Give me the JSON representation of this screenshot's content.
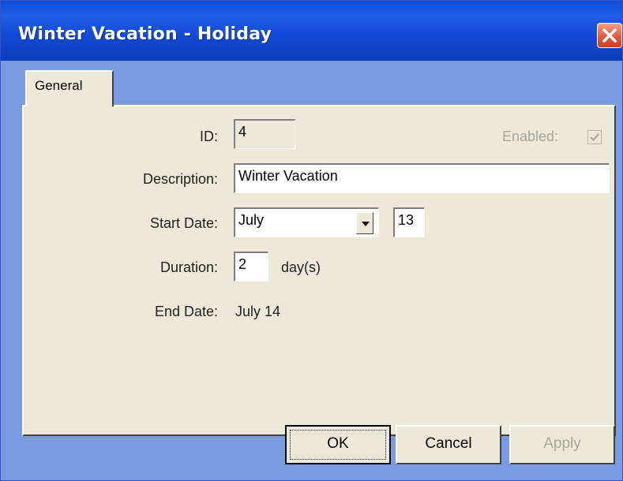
{
  "window": {
    "title": "Winter Vacation - Holiday"
  },
  "tabs": [
    {
      "label": "General"
    }
  ],
  "form": {
    "id_label": "ID:",
    "id_value": "4",
    "enabled_label": "Enabled:",
    "enabled_checked": true,
    "description_label": "Description:",
    "description_value": "Winter Vacation",
    "start_date_label": "Start Date:",
    "start_month_value": "July",
    "start_day_value": "13",
    "duration_label": "Duration:",
    "duration_value": "2",
    "duration_unit": "day(s)",
    "end_date_label": "End Date:",
    "end_date_value": "July 14"
  },
  "buttons": {
    "ok": "OK",
    "cancel": "Cancel",
    "apply": "Apply"
  },
  "icons": {
    "close": "close-icon",
    "dropdown": "chevron-down-icon",
    "check": "check-icon"
  },
  "colors": {
    "titlebar": "#0d4ed9",
    "frame": "#7b9be1",
    "dialog": "#ece9d8",
    "close": "#e0603e"
  }
}
